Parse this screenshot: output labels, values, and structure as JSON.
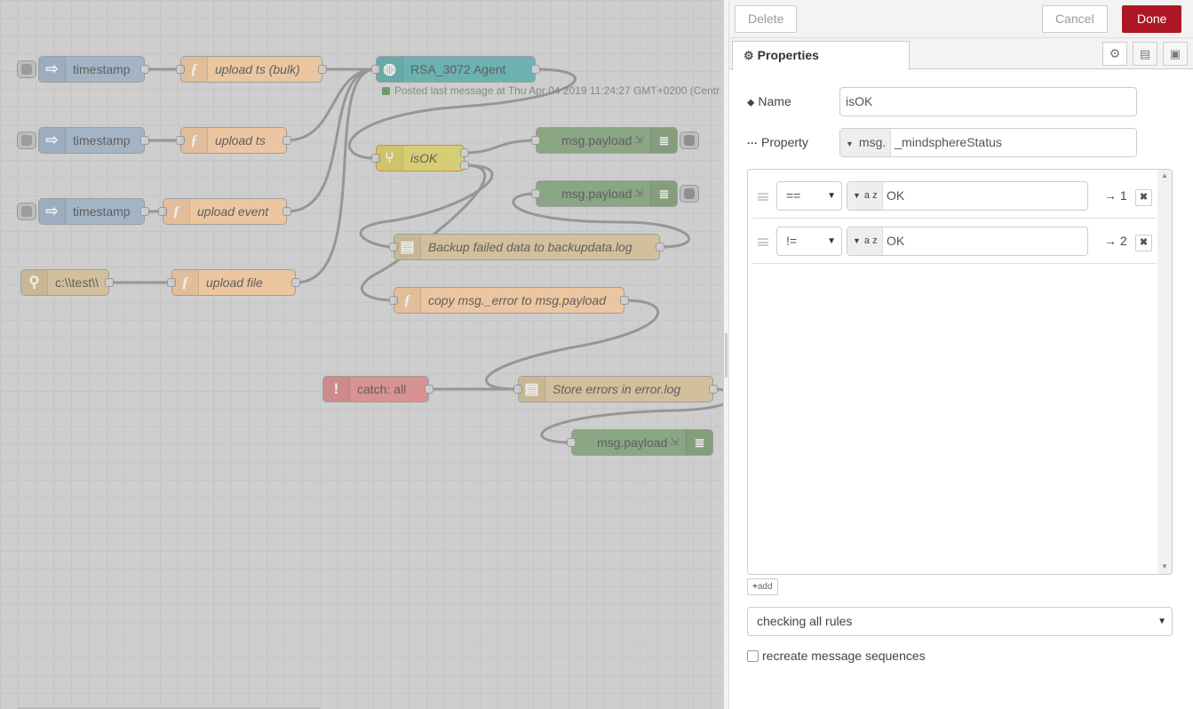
{
  "workspace": {
    "nodes": [
      {
        "id": "n1",
        "label": "timestamp",
        "type": "inject"
      },
      {
        "id": "n2",
        "label": "timestamp",
        "type": "inject"
      },
      {
        "id": "n3",
        "label": "timestamp",
        "type": "inject"
      },
      {
        "id": "n4",
        "label": "c:\\\\test\\\\",
        "type": "watch"
      },
      {
        "id": "n5",
        "label": "upload ts (bulk)",
        "type": "function"
      },
      {
        "id": "n6",
        "label": "upload ts",
        "type": "function"
      },
      {
        "id": "n7",
        "label": "upload event",
        "type": "function"
      },
      {
        "id": "n8",
        "label": "upload file",
        "type": "function"
      },
      {
        "id": "n9",
        "label": "RSA_3072 Agent",
        "type": "mindsphere"
      },
      {
        "id": "n10",
        "label": "isOK",
        "type": "switch"
      },
      {
        "id": "n11",
        "label": "msg.payload",
        "type": "debug"
      },
      {
        "id": "n12",
        "label": "msg.payload",
        "type": "debug"
      },
      {
        "id": "n13",
        "label": "Backup failed data to backupdata.log",
        "type": "file"
      },
      {
        "id": "n14",
        "label": "copy msg._error to msg.payload",
        "type": "function"
      },
      {
        "id": "n15",
        "label": "catch: all",
        "type": "catch"
      },
      {
        "id": "n16",
        "label": "Store errors in error.log",
        "type": "file"
      },
      {
        "id": "n17",
        "label": "msg.payload",
        "type": "debug"
      }
    ],
    "agent_status": "Posted last message at Thu Apr 04 2019 11:24:27 GMT+0200 (Centr"
  },
  "toolbar": {
    "delete_label": "Delete",
    "cancel_label": "Cancel",
    "done_label": "Done",
    "done_color": "#ad1625"
  },
  "tabs": {
    "properties_label": "Properties"
  },
  "form": {
    "name_label": "Name",
    "name_value": "isOK",
    "property_label": "Property",
    "property_prefix": "msg.",
    "property_value": "_mindsphereStatus",
    "rules": [
      {
        "operator": "==",
        "type_icon": "a z",
        "value": "OK",
        "output": "→ 1"
      },
      {
        "operator": "!=",
        "type_icon": "a z",
        "value": "OK",
        "output": "→ 2"
      }
    ],
    "add_label": "add",
    "checking_mode": "checking all rules",
    "recreate_label": "recreate message sequences",
    "recreate_checked": false
  }
}
